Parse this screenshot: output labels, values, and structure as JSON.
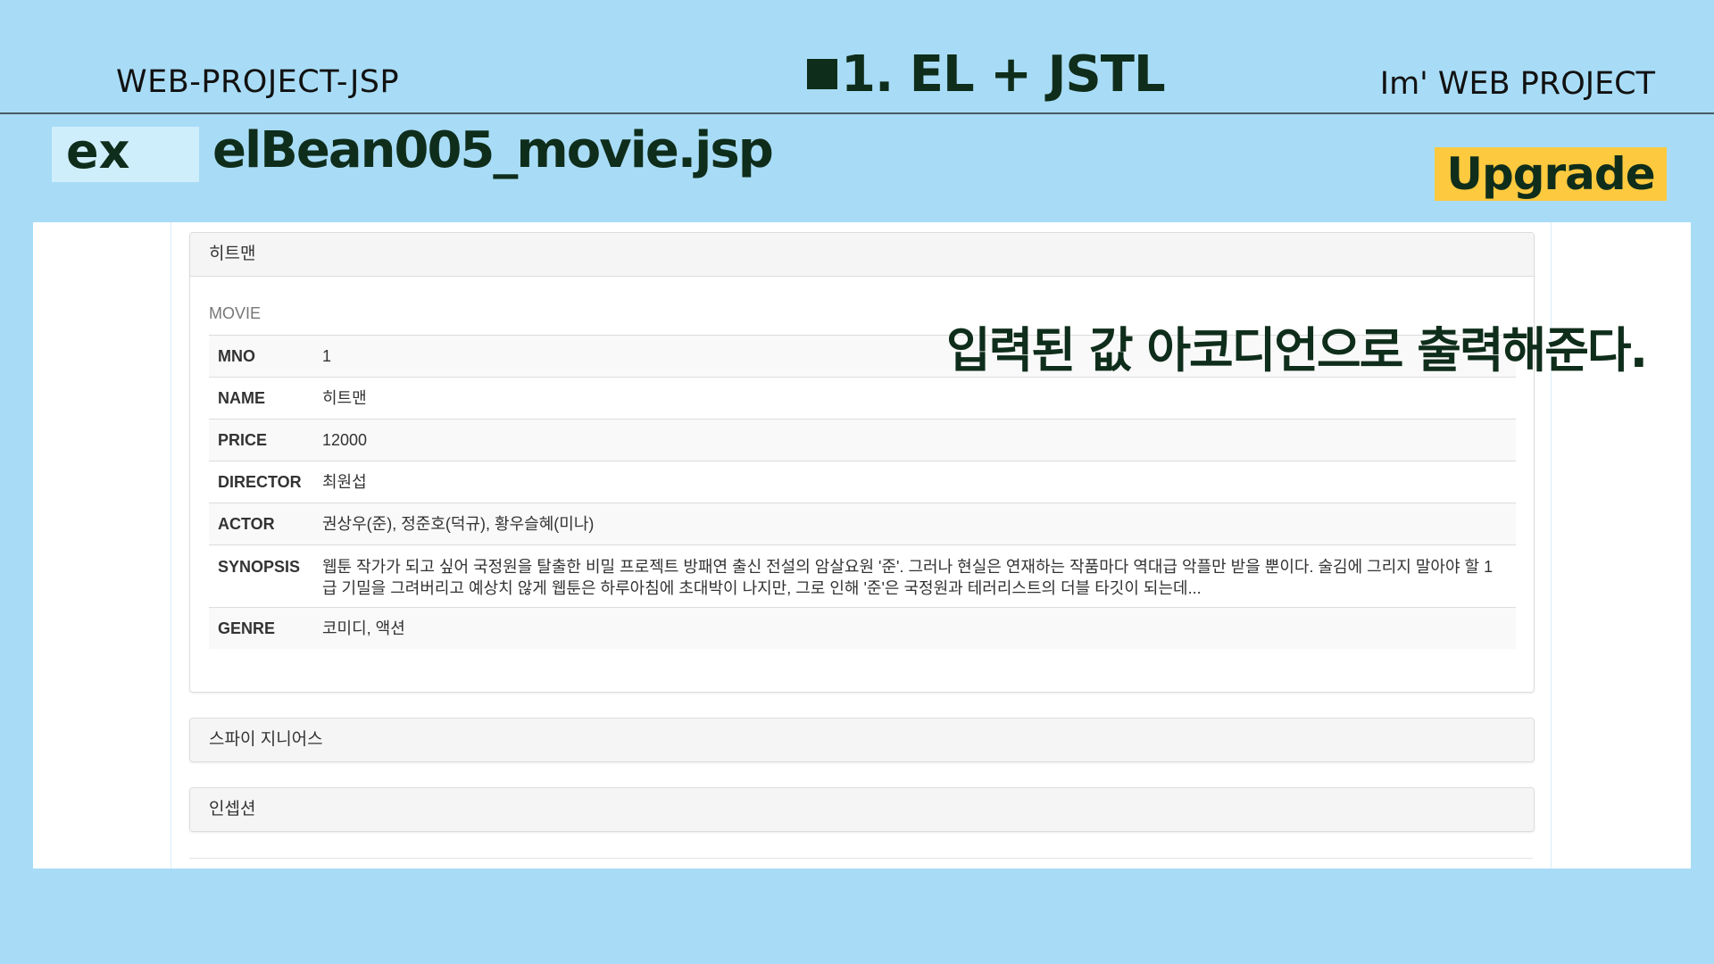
{
  "header": {
    "left": "WEB-PROJECT-JSP",
    "center": "1. EL + JSTL",
    "right": "Im'  WEB PROJECT"
  },
  "example": {
    "label": "ex",
    "filename": "elBean005_movie.jsp"
  },
  "badge": "Upgrade",
  "notice": "입력된 값 아코디언으로 출력해준다.",
  "accordion": {
    "open_panel": {
      "title": "히트맨",
      "caption": "MOVIE",
      "rows": [
        {
          "key": "MNO",
          "value": "1"
        },
        {
          "key": "NAME",
          "value": "히트맨"
        },
        {
          "key": "PRICE",
          "value": "12000"
        },
        {
          "key": "DIRECTOR",
          "value": "최원섭"
        },
        {
          "key": "ACTOR",
          "value": "권상우(준), 정준호(덕규), 황우슬혜(미나)"
        },
        {
          "key": "SYNOPSIS",
          "value": "웹툰 작가가 되고 싶어 국정원을 탈출한 비밀 프로젝트 방패연 출신 전설의 암살요원 '준'. 그러나 현실은 연재하는 작품마다 역대급 악플만 받을 뿐이다. 술김에 그리지 말아야 할 1급 기밀을 그려버리고 예상치 않게 웹툰은 하루아침에 초대박이 나지만, 그로 인해 '준'은 국정원과 테러리스트의 더블 타깃이 되는데..."
        },
        {
          "key": "GENRE",
          "value": "코미디, 액션"
        }
      ]
    },
    "collapsed_panels": [
      {
        "title": "스파이 지니어스"
      },
      {
        "title": "인셉션"
      }
    ]
  }
}
